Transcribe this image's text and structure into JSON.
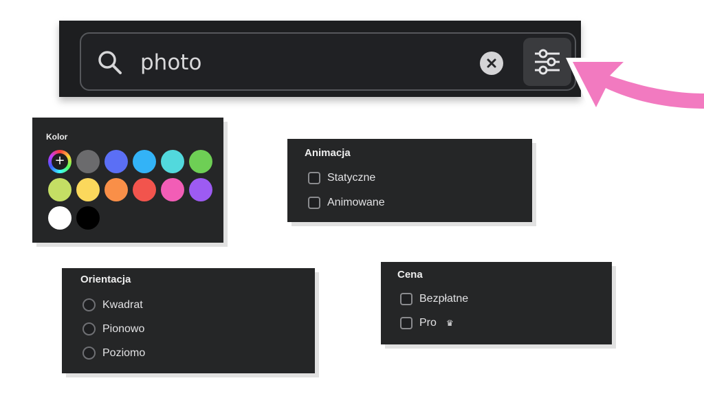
{
  "search": {
    "value": "photo",
    "icon": "search-icon",
    "clear_icon": "clear-icon",
    "filter_icon": "sliders-icon"
  },
  "annotation": {
    "arrow_color": "#f27ac0",
    "arrow_icon": "arrow-icon"
  },
  "color_filter": {
    "title": "Kolor",
    "picker_icon": "plus-icon",
    "swatches": [
      "#6b6b6d",
      "#5b6ff5",
      "#33b3f7",
      "#52d9dd",
      "#6ecf55",
      "#c4de64",
      "#fbd85c",
      "#f98f48",
      "#f2544d",
      "#f25db6",
      "#9d5bf2",
      "#ffffff",
      "#000000"
    ]
  },
  "animation_filter": {
    "title": "Animacja",
    "options": [
      {
        "label": "Statyczne",
        "checked": false
      },
      {
        "label": "Animowane",
        "checked": false
      }
    ]
  },
  "orientation_filter": {
    "title": "Orientacja",
    "options": [
      {
        "label": "Kwadrat",
        "selected": false
      },
      {
        "label": "Pionowo",
        "selected": false
      },
      {
        "label": "Poziomo",
        "selected": false
      }
    ]
  },
  "price_filter": {
    "title": "Cena",
    "options": [
      {
        "label": "Bezpłatne",
        "checked": false
      },
      {
        "label": "Pro",
        "checked": false,
        "icon": "crown-icon"
      }
    ]
  }
}
